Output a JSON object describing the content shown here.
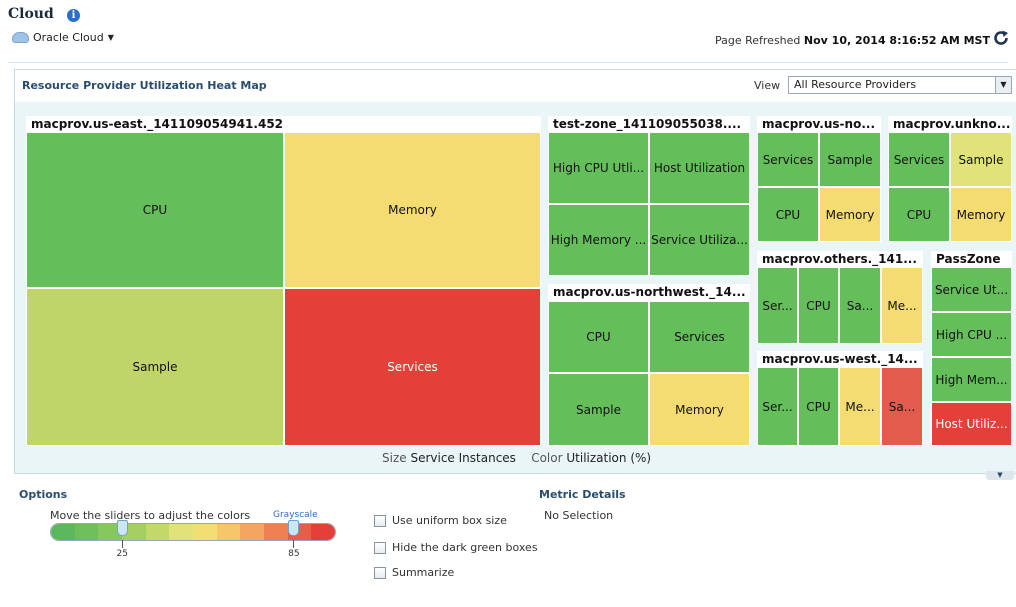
{
  "page": {
    "title": "Cloud",
    "target_selector": "Oracle Cloud",
    "refresh_prefix": "Page Refreshed",
    "refresh_time": "Nov 10, 2014 8:16:52 AM MST"
  },
  "heatmap": {
    "title": "Resource Provider Utilization Heat Map",
    "view_label": "View",
    "view_value": "All Resource Providers",
    "size_label": "Size",
    "size_value": "Service Instances",
    "color_label": "Color",
    "color_value": "Utilization (%)",
    "colors": {
      "dark_green": "#5cb85c",
      "green": "#64be5a",
      "light_green": "#bfd56a",
      "yellow_green": "#dfe37a",
      "yellow": "#f4dc72",
      "red": "#e4403a",
      "light_red": "#e35b4c"
    },
    "groups": [
      {
        "title": "macprov.us-east._141109054941.452",
        "cells": [
          {
            "label": "CPU",
            "color": "green"
          },
          {
            "label": "Memory",
            "color": "yellow"
          },
          {
            "label": "Sample",
            "color": "light_green"
          },
          {
            "label": "Services",
            "color": "red"
          }
        ]
      },
      {
        "title": "test-zone_141109055038....",
        "cells": [
          {
            "label": "High CPU Utli...",
            "color": "green"
          },
          {
            "label": "Host Utilization",
            "color": "green"
          },
          {
            "label": "High Memory ...",
            "color": "green"
          },
          {
            "label": "Service Utiliza...",
            "color": "green"
          }
        ]
      },
      {
        "title": "macprov.us-northwest._14...",
        "cells": [
          {
            "label": "CPU",
            "color": "green"
          },
          {
            "label": "Services",
            "color": "green"
          },
          {
            "label": "Sample",
            "color": "green"
          },
          {
            "label": "Memory",
            "color": "yellow"
          }
        ]
      },
      {
        "title": "macprov.us-no...",
        "cells": [
          {
            "label": "Services",
            "color": "green"
          },
          {
            "label": "Sample",
            "color": "green"
          },
          {
            "label": "CPU",
            "color": "green"
          },
          {
            "label": "Memory",
            "color": "yellow"
          }
        ]
      },
      {
        "title": "macprov.unkno...",
        "cells": [
          {
            "label": "Services",
            "color": "green"
          },
          {
            "label": "Sample",
            "color": "yellow_green"
          },
          {
            "label": "CPU",
            "color": "green"
          },
          {
            "label": "Memory",
            "color": "yellow"
          }
        ]
      },
      {
        "title": "macprov.others._141...",
        "cells": [
          {
            "label": "Ser...",
            "color": "green"
          },
          {
            "label": "CPU",
            "color": "green"
          },
          {
            "label": "Sa...",
            "color": "green"
          },
          {
            "label": "Me...",
            "color": "yellow"
          }
        ]
      },
      {
        "title": "macprov.us-west._14...",
        "cells": [
          {
            "label": "Ser...",
            "color": "green"
          },
          {
            "label": "CPU",
            "color": "green"
          },
          {
            "label": "Me...",
            "color": "yellow"
          },
          {
            "label": "Sa...",
            "color": "light_red"
          }
        ]
      },
      {
        "title": "PassZone",
        "cells": [
          {
            "label": "Service Ut...",
            "color": "green"
          },
          {
            "label": "High CPU ...",
            "color": "green"
          },
          {
            "label": "High Mem...",
            "color": "green"
          },
          {
            "label": "Host Utiliz...",
            "color": "red"
          }
        ]
      }
    ]
  },
  "options": {
    "title": "Options",
    "slider_instructions": "Move the sliders to adjust the colors",
    "grayscale_link": "Grayscale",
    "slider_low": 25,
    "slider_high": 85,
    "slider_low_label": "25",
    "slider_high_label": "85",
    "scale_colors": [
      "#5cb85c",
      "#6dbf5c",
      "#86c75e",
      "#a4cf62",
      "#c2d96a",
      "#dfe37a",
      "#f2de73",
      "#f6c66a",
      "#f3a560",
      "#ee8054",
      "#e85d47",
      "#e4403a"
    ],
    "checkboxes": [
      {
        "label": "Use uniform box size",
        "checked": false
      },
      {
        "label": "Hide the dark green boxes",
        "checked": false
      },
      {
        "label": "Summarize",
        "checked": false
      }
    ]
  },
  "metric_details": {
    "title": "Metric Details",
    "value": "No Selection"
  }
}
